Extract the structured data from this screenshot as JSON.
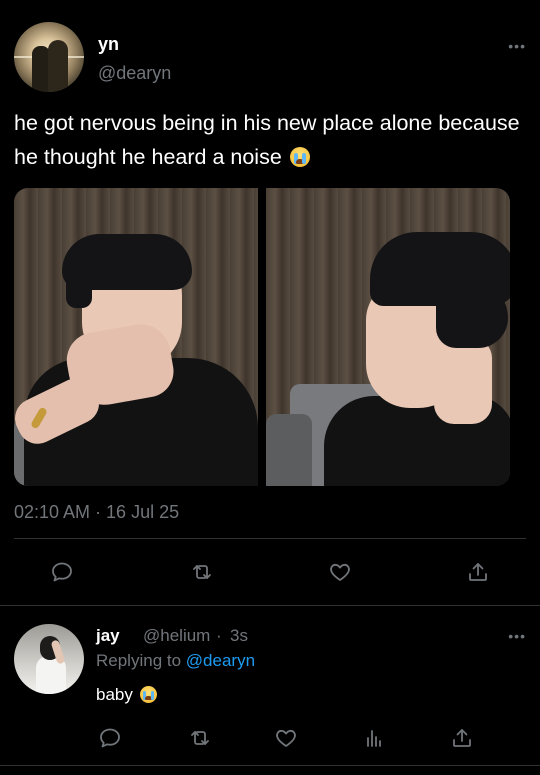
{
  "tweet": {
    "display_name": "yn",
    "handle": "@dearyn",
    "more_icon": "more-horizontal-icon",
    "text": "he got nervous being in his new place alone because he thought he heard a noise",
    "emoji": "loudly-crying-face-emoji",
    "timestamp": "02:10 AM · 16 Jul 25",
    "media": [
      "photo-man-covering-mouth",
      "photo-man-looking-sideways"
    ],
    "actions": [
      "reply-icon",
      "retweet-icon",
      "like-icon",
      "share-icon"
    ]
  },
  "reply": {
    "display_name": "jay",
    "handle": "@helium",
    "separator": "·",
    "time": "3s",
    "replying_prefix": "Replying to",
    "replying_to": "@dearyn",
    "text": "baby",
    "emoji": "loudly-crying-face-emoji",
    "actions": [
      "reply-icon",
      "retweet-icon",
      "like-icon",
      "analytics-icon",
      "share-icon"
    ]
  },
  "colors": {
    "background": "#000000",
    "text": "#ffffff",
    "secondary": "#71767b",
    "link": "#1d9bf0",
    "divider": "#2f3336"
  }
}
